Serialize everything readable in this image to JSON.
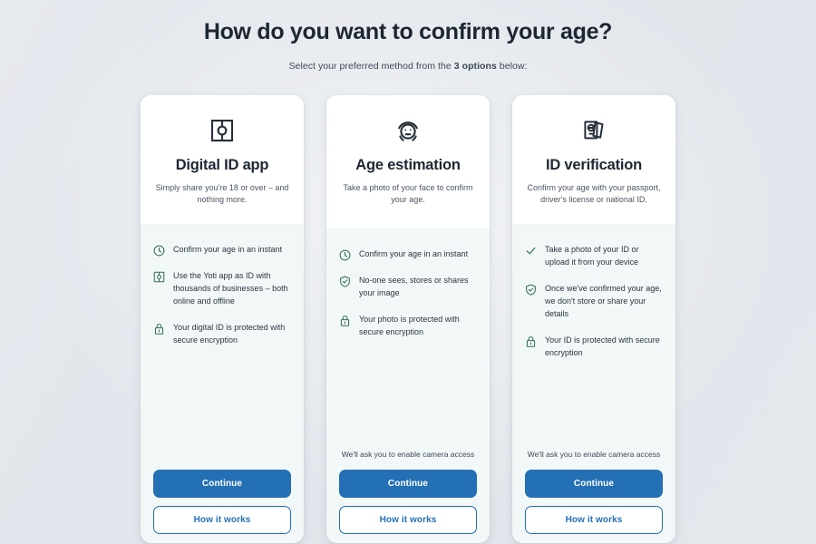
{
  "header": {
    "title": "How do you want to confirm your age?",
    "subtitle_before": "Select your preferred method from the ",
    "subtitle_bold": "3 options",
    "subtitle_after": " below:"
  },
  "theme": {
    "primary_blue": "#2470b4",
    "feature_green": "#2f6d55",
    "page_background": "#e2e5ea",
    "card_tint": "#f2f7f7",
    "heading_color": "#1d2733"
  },
  "buttons": {
    "continue_label": "Continue",
    "how_it_works_label": "How it works"
  },
  "cards": [
    {
      "id": "digital-id-app",
      "icon": "digital-id-icon",
      "title": "Digital ID app",
      "description": "Simply share you're 18 or over – and nothing more.",
      "camera_note": "",
      "features": [
        {
          "icon": "clock-icon",
          "text": "Confirm your age in an instant"
        },
        {
          "icon": "id-card-icon",
          "text": "Use the Yoti app as ID with thousands of businesses – both online and offline"
        },
        {
          "icon": "lock-icon",
          "text": "Your digital ID is protected with secure encryption"
        }
      ]
    },
    {
      "id": "age-estimation",
      "icon": "face-scan-icon",
      "title": "Age estimation",
      "description": "Take a photo of your face to confirm your age.",
      "camera_note": "We'll ask you to enable camera access",
      "features": [
        {
          "icon": "clock-icon",
          "text": "Confirm your age in an instant"
        },
        {
          "icon": "shield-check-icon",
          "text": "No-one sees, stores or shares your image"
        },
        {
          "icon": "lock-icon",
          "text": "Your photo is protected with secure encryption"
        }
      ]
    },
    {
      "id": "id-verification",
      "icon": "passport-documents-icon",
      "title": "ID verification",
      "description": "Confirm your age with your passport, driver's license or national ID.",
      "camera_note": "We'll ask you to enable camera access",
      "features": [
        {
          "icon": "check-icon",
          "text": "Take a photo of your ID or upload it from your device"
        },
        {
          "icon": "shield-check-icon",
          "text": "Once we've confirmed your age, we don't store or share your details"
        },
        {
          "icon": "lock-icon",
          "text": "Your ID is protected with secure encryption"
        }
      ]
    }
  ]
}
